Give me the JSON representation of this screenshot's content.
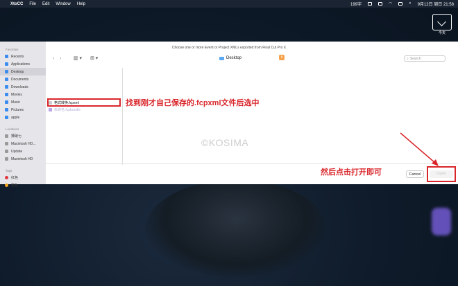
{
  "menubar": {
    "app_name": "XtoCC",
    "menus": [
      "File",
      "Edit",
      "Window",
      "Help"
    ],
    "status_text": "199字",
    "clock": "9月12日 周日 21:58"
  },
  "desktop_widget": {
    "label": "今天"
  },
  "dialog": {
    "title": "Choose one or more Event or Project XMLs exported from Final Cut Pro X",
    "location": "Desktop",
    "search_placeholder": "Search",
    "cancel_label": "Cancel",
    "open_label": "Open"
  },
  "sidebar": {
    "favorites_label": "Favorites",
    "favorites": [
      {
        "label": "Recents"
      },
      {
        "label": "Applications"
      },
      {
        "label": "Desktop"
      },
      {
        "label": "Documents"
      },
      {
        "label": "Downloads"
      },
      {
        "label": "Movies"
      },
      {
        "label": "Music"
      },
      {
        "label": "Pictures"
      },
      {
        "label": "apple"
      }
    ],
    "locations_label": "Locations",
    "locations": [
      {
        "label": "狮破七"
      },
      {
        "label": "Macintosh HD..."
      },
      {
        "label": "Update"
      },
      {
        "label": "Macintosh HD"
      }
    ],
    "tags_label": "Tags",
    "tags": [
      {
        "label": "红色"
      },
      {
        "label": "橙色"
      }
    ]
  },
  "files": [
    {
      "name": "格式转换.fcpxml",
      "enabled": true
    },
    {
      "name": "未命名.fcpbundle",
      "enabled": false
    }
  ],
  "annotations": {
    "find_file": "找到刚才自己保存的.fcpxml文件后选中",
    "click_open": "然后点击打开即可",
    "watermark": "©KOSIMA"
  },
  "colors": {
    "annotation_red": "#d9262b",
    "accent_blue": "#3a8cf0"
  }
}
